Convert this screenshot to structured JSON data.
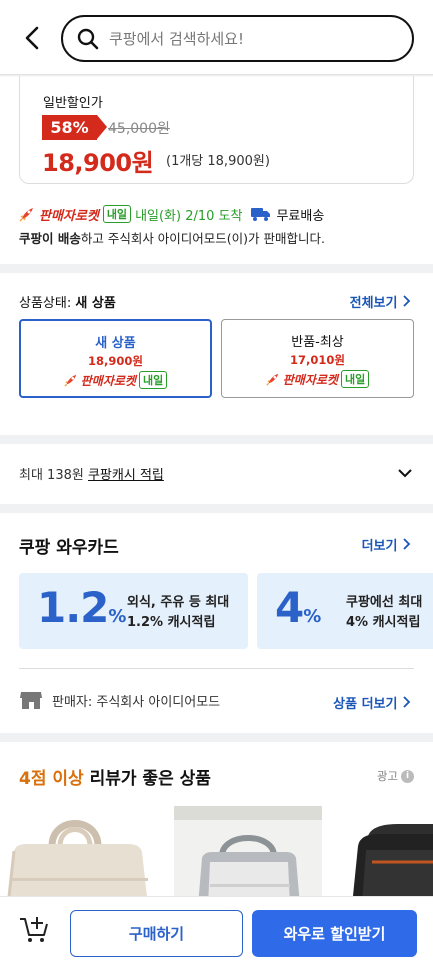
{
  "header": {
    "search_placeholder": "쿠팡에서 검색하세요!"
  },
  "price": {
    "label": "일반할인가",
    "discount_rate": "58%",
    "original_price": "45,000원",
    "sale_price": "18,900원",
    "unit_price": "(1개당 18,900원)"
  },
  "delivery": {
    "rocket_label": "판매자로켓",
    "tomorrow_badge": "내일",
    "arrival": "내일(화) 2/10 도착",
    "free_shipping": "무료배송",
    "seller_bold": "쿠팡이 배송",
    "seller_rest": "하고 주식회사 아이디어모드(이)가 판매합니다."
  },
  "condition": {
    "label_prefix": "상품상태:",
    "label_value": "새 상품",
    "see_all": "전체보기",
    "options": [
      {
        "name": "새 상품",
        "price": "18,900원",
        "rocket": "판매자로켓",
        "badge": "내일",
        "selected": true
      },
      {
        "name": "반품-최상",
        "price": "17,010원",
        "rocket": "판매자로켓",
        "badge": "내일",
        "selected": false
      }
    ]
  },
  "cash": {
    "prefix": "최대 138원",
    "link": "쿠팡캐시 적립"
  },
  "wow": {
    "title": "쿠팡 와우카드",
    "more": "더보기",
    "promos": [
      {
        "big": "1.2",
        "pct": "%",
        "line1": "외식, 주유 등 최대",
        "line2": "1.2% 캐시적립"
      },
      {
        "big": "4",
        "pct": "%",
        "line1": "쿠팡에선 최대",
        "line2": "4% 캐시적립"
      }
    ]
  },
  "seller": {
    "label": "판매자: 주식회사 아이디어모드",
    "more": "상품 더보기"
  },
  "recommend": {
    "title_highlight": "4점 이상",
    "title_rest": " 리뷰가 좋은 상품",
    "ad": "광고"
  },
  "bottom": {
    "buy": "구매하기",
    "wow_buy": "와우로 할인받기"
  },
  "colors": {
    "brand_blue": "#2b62c9",
    "price_red": "#d42a1c",
    "green": "#2a9d2a",
    "review_orange": "#d9700b"
  }
}
